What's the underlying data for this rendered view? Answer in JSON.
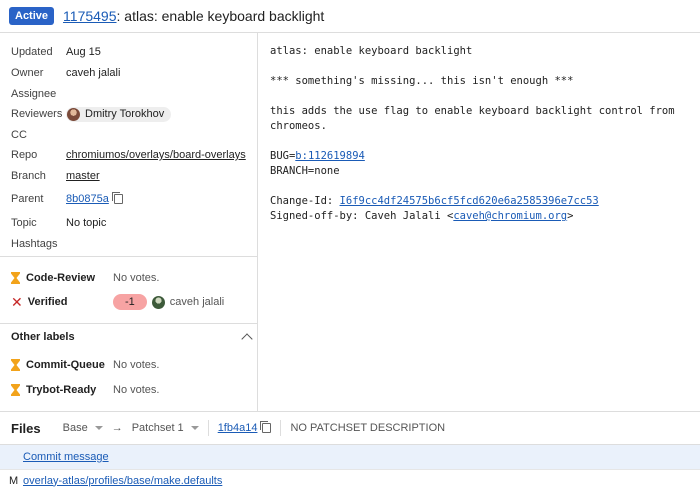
{
  "header": {
    "status": "Active",
    "change_number": "1175495",
    "title_rest": ": atlas: enable keyboard backlight"
  },
  "metadata": [
    {
      "label": "Updated",
      "value": "Aug 15"
    },
    {
      "label": "Owner",
      "value": "caveh jalali"
    },
    {
      "label": "Assignee",
      "value": ""
    },
    {
      "label": "Reviewers",
      "value": "Dmitry Torokhov"
    },
    {
      "label": "CC",
      "value": ""
    },
    {
      "label": "Repo",
      "value": "chromiumos/overlays/board-overlays"
    },
    {
      "label": "Branch",
      "value": "master"
    },
    {
      "label": "Parent",
      "value": "8b0875a"
    },
    {
      "label": "Topic",
      "value": "No topic"
    },
    {
      "label": "Hashtags",
      "value": ""
    }
  ],
  "labels": {
    "code_review": {
      "name": "Code-Review",
      "votes": "No votes.",
      "icon": "hourglass-icon"
    },
    "verified": {
      "name": "Verified",
      "vote": "-1",
      "voter": "caveh jalali",
      "icon": "x-icon"
    },
    "other_labels_title": "Other labels",
    "commit_queue": {
      "name": "Commit-Queue",
      "votes": "No votes."
    },
    "trybot_ready": {
      "name": "Trybot-Ready",
      "votes": "No votes."
    }
  },
  "commit_message": {
    "subject": "atlas: enable keyboard backlight",
    "line2": "*** something's missing... this isn't enough ***",
    "line3": "this adds the use flag to enable keyboard backlight control from",
    "line4": "chromeos.",
    "bug_prefix": "BUG=",
    "bug_link": "b:112619894",
    "branch_line": "BRANCH=none",
    "change_id_prefix": "Change-Id: ",
    "change_id": "I6f9cc4df24575b6cf5fcd620e6a2585396e7cc53",
    "signed_prefix": "Signed-off-by: Caveh Jalali <",
    "signed_email": "caveh@chromium.org",
    "signed_suffix": ">"
  },
  "files": {
    "title": "Files",
    "base_label": "Base",
    "arrow": "→",
    "patchset_label": "Patchset 1",
    "commit_hash": "1fb4a14",
    "patchset_description": "NO PATCHSET DESCRIPTION",
    "commit_message_link": "Commit message",
    "file_status": "M",
    "file_path": "overlay-atlas/profiles/base/make.defaults"
  },
  "colors": {
    "accent": "#2a63c7",
    "link": "#1a5bb6",
    "negative_vote": "#f7a3a3",
    "hourglass": "#f2a31b",
    "error": "#c62828"
  }
}
